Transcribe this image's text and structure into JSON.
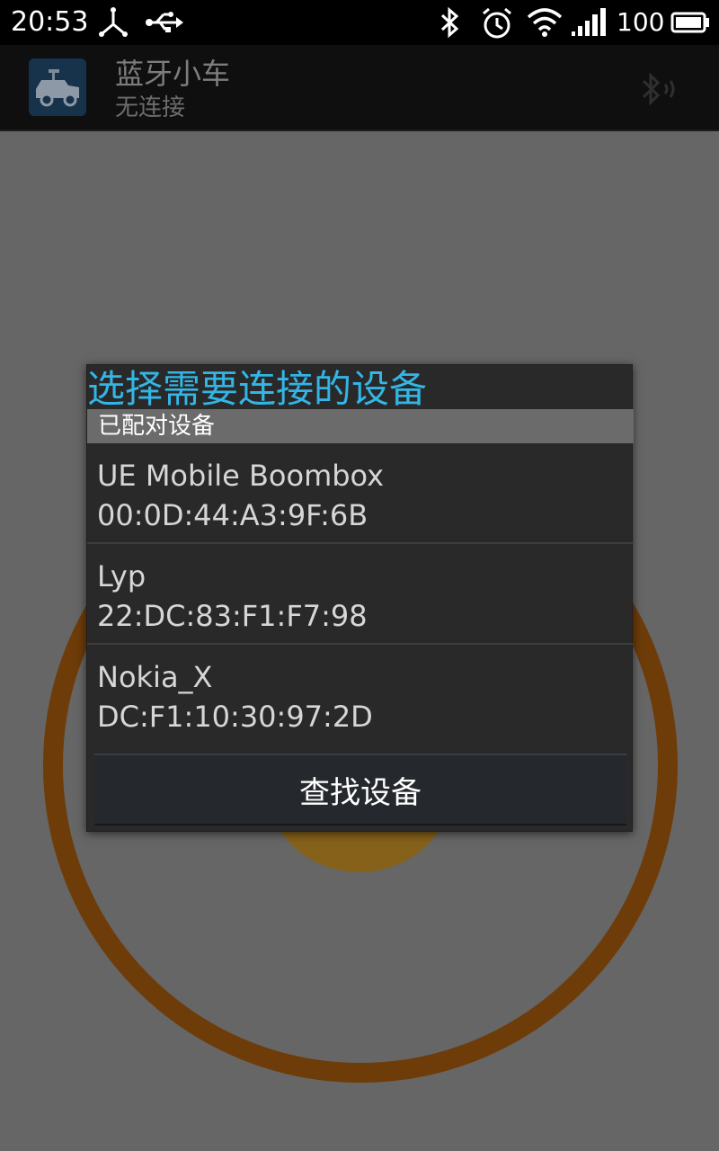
{
  "status_bar": {
    "time": "20:53",
    "battery_level": "100",
    "icons": [
      "usb-debug-icon",
      "usb-icon",
      "bluetooth-icon",
      "alarm-icon",
      "wifi-icon",
      "signal-icon",
      "battery-icon"
    ]
  },
  "action_bar": {
    "title": "蓝牙小车",
    "subtitle": "无连接",
    "icons": [
      "car-app-icon",
      "bluetooth-connect-icon"
    ]
  },
  "dialog": {
    "title": "选择需要连接的设备",
    "section_header": "已配对设备",
    "devices": [
      {
        "name": "UE Mobile Boombox",
        "address": "00:0D:44:A3:9F:6B"
      },
      {
        "name": "Lyp",
        "address": "22:DC:83:F1:F7:98"
      },
      {
        "name": "Nokia_X",
        "address": "DC:F1:10:30:97:2D"
      }
    ],
    "scan_button": "查找设备"
  },
  "colors": {
    "accent": "#33b5e5",
    "scrim": "#666666",
    "dialog_bg": "#292929",
    "ring": "#6e3c09",
    "knob": "#85611a"
  }
}
